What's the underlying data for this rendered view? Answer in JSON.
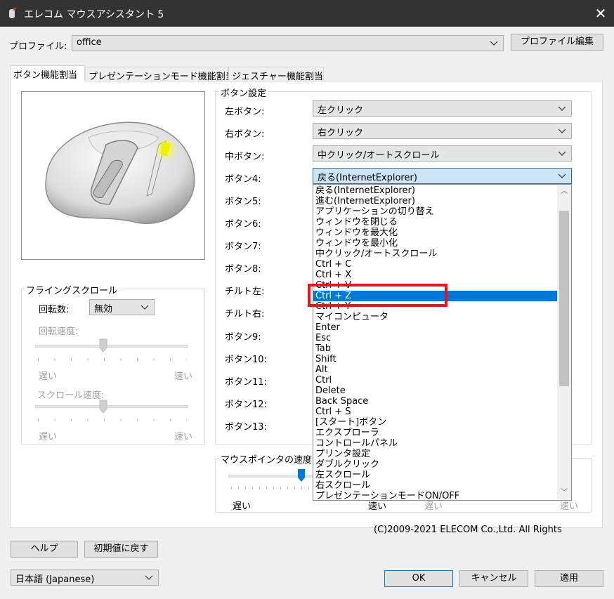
{
  "window": {
    "title": "エレコム マウスアシスタント 5"
  },
  "profile": {
    "label": "プロファイル:",
    "value": "office",
    "edit_button": "プロファイル編集"
  },
  "tabs": [
    "ボタン機能割当",
    "プレゼンテーションモード機能割当",
    "ジェスチャー機能割当"
  ],
  "button_settings": {
    "title": "ボタン設定",
    "rows": [
      {
        "label": "左ボタン:",
        "value": "左クリック"
      },
      {
        "label": "右ボタン:",
        "value": "右クリック"
      },
      {
        "label": "中ボタン:",
        "value": "中クリック/オートスクロール"
      },
      {
        "label": "ボタン4:",
        "value": "戻る(InternetExplorer)"
      },
      {
        "label": "ボタン5:"
      },
      {
        "label": "ボタン6:"
      },
      {
        "label": "ボタン7:"
      },
      {
        "label": "ボタン8:"
      },
      {
        "label": "チルト左:"
      },
      {
        "label": "チルト右:"
      },
      {
        "label": "ボタン9:"
      },
      {
        "label": "ボタン10:"
      },
      {
        "label": "ボタン11:"
      },
      {
        "label": "ボタン12:"
      },
      {
        "label": "ボタン13:"
      }
    ]
  },
  "dropdown_items": [
    "戻る(InternetExplorer)",
    "進む(InternetExplorer)",
    "アプリケーションの切り替え",
    "ウィンドウを閉じる",
    "ウィンドウを最大化",
    "ウィンドウを最小化",
    "中クリック/オートスクロール",
    "Ctrl + C",
    "Ctrl + X",
    "Ctrl + V",
    "Ctrl + Z",
    "Ctrl + Y",
    "マイコンピュータ",
    "Enter",
    "Esc",
    "Tab",
    "Shift",
    "Alt",
    "Ctrl",
    "Delete",
    "Back Space",
    "Ctrl + S",
    "[スタート]ボタン",
    "エクスプローラ",
    "コントロールパネル",
    "プリンタ設定",
    "ダブルクリック",
    "左スクロール",
    "右スクロール",
    "プレゼンテーションモードON/OFF"
  ],
  "dropdown_selected_index": 10,
  "flying_scroll": {
    "title": "フライングスクロール",
    "rotation_label": "回転数:",
    "rotation_value": "無効",
    "speed_label": "回転速度:",
    "scroll_speed_label": "スクロール速度:",
    "slow": "遅い",
    "fast": "速い"
  },
  "pointer_speed": {
    "title": "マウスポインタの速度",
    "slow": "遅い",
    "fast": "速い"
  },
  "copyright": "(C)2009-2021 ELECOM Co.,Ltd. All Rights",
  "footer": {
    "help": "ヘルプ",
    "reset": "初期値に戻す",
    "language": "日本語 (Japanese)",
    "ok": "OK",
    "cancel": "キャンセル",
    "apply": "適用"
  },
  "colors": {
    "titlebar": "#333333",
    "highlight": "#0078d7",
    "annotation": "#e6141c",
    "mouse_led": "#f0f000"
  }
}
